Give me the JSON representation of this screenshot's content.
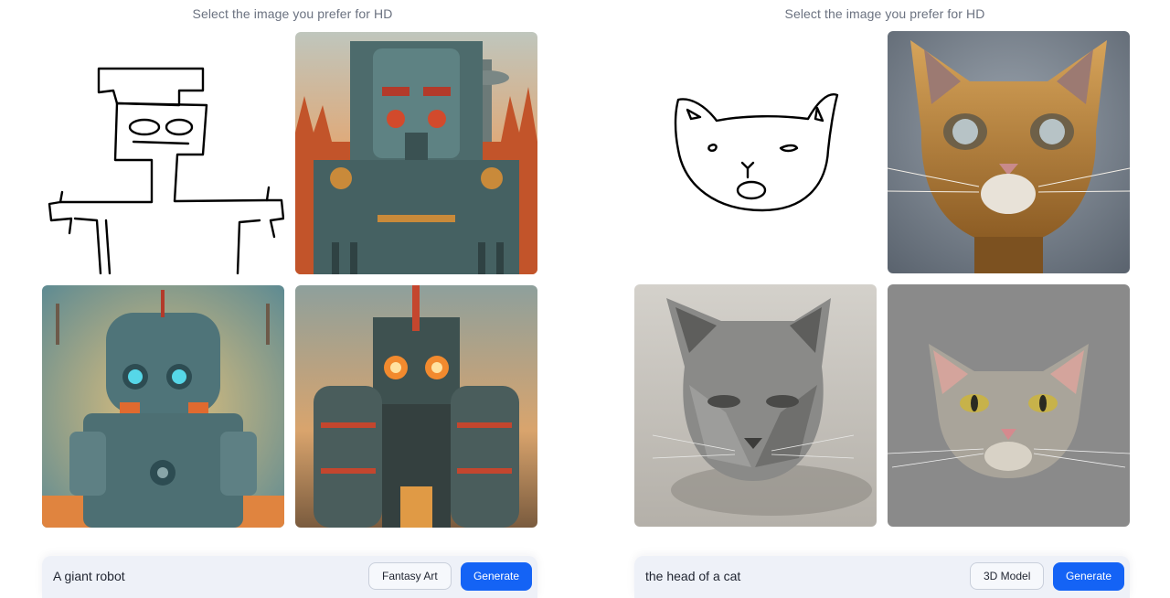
{
  "left_panel": {
    "heading": "Select the image you prefer for HD",
    "images": [
      {
        "name": "sketch",
        "description": "hand-drawn robot sketch"
      },
      {
        "name": "option-1",
        "description": "giant robot fantasy art"
      },
      {
        "name": "option-2",
        "description": "giant robot with blue eyes"
      },
      {
        "name": "option-3",
        "description": "giant robot with glowing orange eyes"
      }
    ],
    "prompt": "A giant robot",
    "style_label": "Fantasy Art",
    "generate_label": "Generate"
  },
  "right_panel": {
    "heading": "Select the image you prefer for HD",
    "images": [
      {
        "name": "sketch",
        "description": "hand-drawn cat head sketch"
      },
      {
        "name": "option-1",
        "description": "golden cat head 3D model"
      },
      {
        "name": "option-2",
        "description": "gray low-poly cat head"
      },
      {
        "name": "option-3",
        "description": "gray realistic cat head"
      }
    ],
    "prompt": "the head of a cat",
    "style_label": "3D Model",
    "generate_label": "Generate"
  },
  "colors": {
    "accent": "#1463f5",
    "prompt_bar": "#eef1f8",
    "heading_text": "#6b7280"
  }
}
